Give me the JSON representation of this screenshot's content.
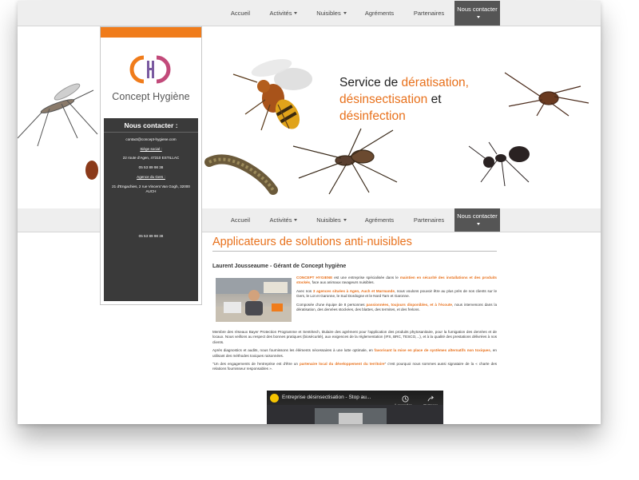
{
  "nav": {
    "items": [
      {
        "label": "Accueil",
        "has_caret": false
      },
      {
        "label": "Activités",
        "has_caret": true
      },
      {
        "label": "Nuisibles",
        "has_caret": true
      },
      {
        "label": "Agréments",
        "has_caret": false
      },
      {
        "label": "Partenaires",
        "has_caret": false
      },
      {
        "label": "Nous contacter",
        "has_caret": true,
        "active": true
      }
    ]
  },
  "hero": {
    "tagline_1": "Service de ",
    "tagline_2": "dératisation,",
    "tagline_3": "désinsectisation",
    "tagline_4": " et",
    "tagline_5": "désinfection"
  },
  "sidebar": {
    "logo_text": "Concept Hygiène",
    "contact_title": "Nous contacter :",
    "email": "contact@concept-hygiene.com",
    "siege_label": "Siège social :",
    "siege_address": "22 route d'Agen, 47310 ESTILLAC",
    "siege_phone": "05 53 89 98 38",
    "gers_label": "Agence du Gers :",
    "gers_address": "21 d'Engachies, 2 rue Vincent Van Gogh, 32000 AUCH",
    "lower_phone": "05 53 89 98 38"
  },
  "main": {
    "title": "Applicateurs de solutions anti-nuisibles",
    "subtitle": "Laurent Jousseaume - Gérant de Concept hygiène",
    "p1_a": "CONCEPT HYGIENE",
    "p1_b": " est une entreprise spécialisée dans le ",
    "p1_c": "maintien en sécurité des installations et des produits stockés",
    "p1_d": ", face aux animaux ravageurs nuisibles.",
    "p2_a": "Avec nos ",
    "p2_b": "3 agences situées à Agen, Auch et Marmande",
    "p2_c": ", nous voulons pouvoir être au plus près de nos clients sur le Gers, le Lot et Garonne, le Sud Dordogne et le Nord Tarn et Garonne.",
    "p3_a": "Composée d'une équipe de 8 personnes ",
    "p3_b": "passionnées, toujours disponibles, et à l'écoute",
    "p3_c": ", nous intervenons dans la dératisation, des denrées stockées, des blattes, des termites, et des frelons.",
    "p4": "Membre des réseaux Bayer Protection Programme et Sentritech, titulaire des agrément pour l'application des produits phytosanitaire, pour la fumigation des denrées et de locaux. Nous veillons au respect des bonnes pratiques (biosécurité), aux exigences de la réglementation (IFS, BRC, TESCO,...), et à la qualité des prestations délivrées à nos clients.",
    "p5_a": "Après diagnostics et audits, nous fournissons les éléments nécessaires à une lutte optimale, en ",
    "p5_b": "favorisant la mise en place de systèmes alternatifs non toxiques",
    "p5_c": ", en utilisant des méthodes toxiques raisonnées.",
    "p6_a": "\"Un des engagements de l'entreprise est d'être un ",
    "p6_b": "partenaire local du développement du territoire",
    "p6_c": "\" c'est pourquoi nous sommes aussi signataire de la « charte des relations fournisseur responsables »."
  },
  "video": {
    "title": "Entreprise désinsectisation - Stop au...",
    "watch_later": "À regarder ...",
    "share": "Partager"
  },
  "colors": {
    "accent": "#e8711c",
    "nav_bg": "#eeeeee",
    "nav_active": "#555555",
    "sidebar_box": "#3a3a3a"
  }
}
